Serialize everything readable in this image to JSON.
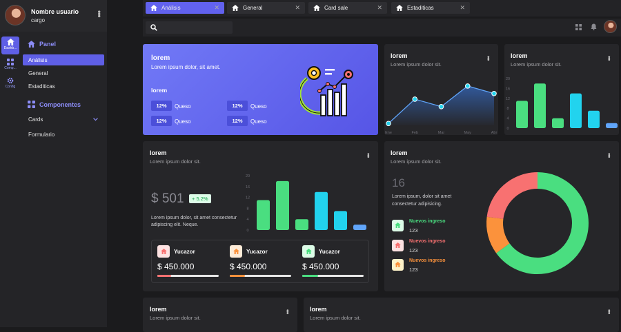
{
  "profile": {
    "name": "Nombre usuario",
    "role": "cargo"
  },
  "rail": [
    {
      "label": "Dashb...",
      "icon": "home-icon"
    },
    {
      "label": "Comp...",
      "icon": "grid-icon"
    },
    {
      "label": "Config",
      "icon": "gear-icon"
    }
  ],
  "sidebar": {
    "panel_title": "Panel",
    "panel_items": [
      {
        "label": "Análisis",
        "active": true
      },
      {
        "label": "General"
      },
      {
        "label": "Estaditicas"
      }
    ],
    "components_title": "Componentes",
    "components_items": [
      {
        "label": "Cards",
        "has_chevron": true
      },
      {
        "label": "Formulario"
      }
    ]
  },
  "tabs": [
    {
      "label": "Análisis",
      "active": true
    },
    {
      "label": "General"
    },
    {
      "label": "Card sale"
    },
    {
      "label": "Estaditicas"
    }
  ],
  "colors": {
    "accent": "#5f5fe6",
    "green": "#4ade80",
    "cyan": "#22d3ee",
    "red": "#f87171",
    "orange": "#fb923c",
    "blue": "#60a5fa"
  },
  "hero": {
    "title": "lorem",
    "subtitle": "Lorem ipsum dolor, sit amet.",
    "section": "lorem",
    "stats": [
      {
        "pill": "12%",
        "label": "Queso"
      },
      {
        "pill": "12%",
        "label": "Queso"
      },
      {
        "pill": "12%",
        "label": "Queso"
      },
      {
        "pill": "12%",
        "label": "Queso"
      }
    ]
  },
  "line_card": {
    "title": "lorem",
    "subtitle": "Lorem ipsum dolor sit."
  },
  "bar_card": {
    "title": "lorem",
    "subtitle": "Lorem ipsum dolor sit."
  },
  "sales_card": {
    "title": "lorem",
    "subtitle": "Lorem ipsum dolor sit.",
    "amount": "$ 501",
    "badge": "+ 5.2%",
    "description": "Lorem ipsum dolor, sit amet consectetur adipiscing elit. Neque.",
    "sellers": [
      {
        "name": "Yucazor",
        "amount": "$ 450.000",
        "color": "#f87171",
        "progress": 0.22
      },
      {
        "name": "Yucazor",
        "amount": "$ 450.000",
        "color": "#fb923c",
        "progress": 0.25
      },
      {
        "name": "Yucazor",
        "amount": "$ 450.000",
        "color": "#4ade80",
        "progress": 0.26
      }
    ]
  },
  "donut_card": {
    "title": "lorem",
    "subtitle": "Lorem ipsum dolor sit.",
    "number": "16",
    "description": "Lorem ipsum, dolor sit amet consectetur adipisicing.",
    "legend": [
      {
        "label": "Nuevos ingreso",
        "value": "123",
        "color": "#4ade80"
      },
      {
        "label": "Nuevos ingreso",
        "value": "123",
        "color": "#f87171"
      },
      {
        "label": "Nuevos ingreso",
        "value": "123",
        "color": "#fb923c"
      }
    ]
  },
  "bottom_cards": [
    {
      "title": "lorem",
      "subtitle": "Lorem ipsum dolor sit."
    },
    {
      "title": "lorem",
      "subtitle": "Lorem ipsum dolor sit."
    }
  ],
  "chart_data": [
    {
      "type": "area",
      "categories": [
        "Ene",
        "Feb",
        "Mar",
        "May",
        "Abr"
      ],
      "values": [
        1,
        14,
        10,
        21,
        17
      ],
      "ylim": [
        0,
        25
      ],
      "color": "#60a5fa"
    },
    {
      "type": "bar",
      "values": [
        11,
        18,
        4,
        14,
        7,
        2
      ],
      "colors": [
        "#4ade80",
        "#4ade80",
        "#4ade80",
        "#22d3ee",
        "#22d3ee",
        "#60a5fa"
      ],
      "yticks": [
        0,
        4,
        8,
        12,
        16,
        20
      ],
      "ylim": [
        0,
        20
      ]
    },
    {
      "type": "bar",
      "values": [
        11,
        18,
        4,
        14,
        7,
        2
      ],
      "colors": [
        "#4ade80",
        "#4ade80",
        "#4ade80",
        "#22d3ee",
        "#22d3ee",
        "#60a5fa"
      ],
      "yticks": [
        0,
        4,
        8,
        12,
        16,
        20
      ],
      "ylim": [
        0,
        20
      ]
    },
    {
      "type": "pie",
      "labels": [
        "green",
        "orange",
        "red"
      ],
      "values": [
        65,
        12,
        23
      ],
      "colors": [
        "#4ade80",
        "#fb923c",
        "#f87171"
      ]
    }
  ]
}
